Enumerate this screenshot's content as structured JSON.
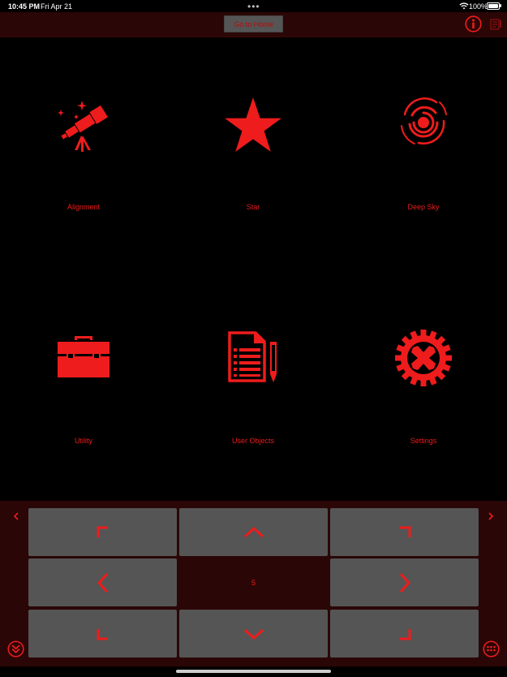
{
  "status_bar": {
    "time": "10:45 PM",
    "date": "Fri Apr 21",
    "battery": "100%"
  },
  "top_bar": {
    "goto_label": "Go to Home"
  },
  "menu": {
    "alignment": "Alignment",
    "star": "Star",
    "deep_sky": "Deep Sky",
    "utility": "Utility",
    "user_objects": "User Objects",
    "settings": "Settings"
  },
  "controller": {
    "speed": "5"
  },
  "colors": {
    "accent": "#ee1c1c",
    "background": "#000000",
    "panel": "#2b0606",
    "button": "#555555"
  }
}
